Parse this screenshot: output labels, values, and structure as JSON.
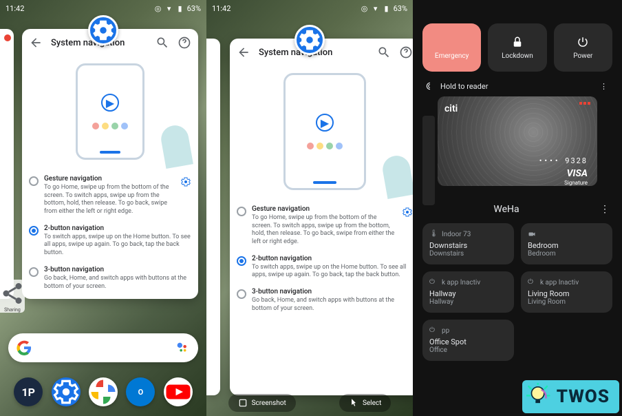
{
  "status": {
    "time1": "11:42",
    "time2": "11:42",
    "battery": "63%"
  },
  "sysnav": {
    "title": "System navigation",
    "options": [
      {
        "key": "gesture",
        "title": "Gesture navigation",
        "desc": "To go Home, swipe up from the bottom of the screen. To switch apps, swipe up from the bottom, hold, then release. To go back, swipe from either the left or right edge."
      },
      {
        "key": "two",
        "title": "2-button navigation",
        "desc": "To switch apps, swipe up on the Home button. To see all apps, swipe up again. To go back, tap the back button."
      },
      {
        "key": "three",
        "title": "3-button navigation",
        "desc": "Go back, Home, and switch apps with buttons at the bottom of your screen."
      }
    ]
  },
  "panel1": {
    "selected": "two",
    "sharing_label": "Sharing"
  },
  "panel2": {
    "selected": "two",
    "actions": {
      "screenshot": "Screenshot",
      "select": "Select"
    }
  },
  "power": {
    "buttons": {
      "emergency": "Emergency",
      "lockdown": "Lockdown",
      "power": "Power"
    },
    "wallet_hint": "Hold to reader",
    "card": {
      "brand": "citi",
      "last4": "9328",
      "network": "VISA",
      "tier": "Signature"
    },
    "home": "WeHa",
    "tiles": [
      {
        "icon": "thermo",
        "status": "Indoor 73",
        "name": "Downstairs",
        "room": "Downstairs"
      },
      {
        "icon": "camera",
        "status": "",
        "name": "Bedroom",
        "room": "Bedroom"
      },
      {
        "icon": "power",
        "status": "k app      Inactiv",
        "name": "Hallway",
        "room": "Hallway"
      },
      {
        "icon": "power",
        "status": "k app      Inactiv",
        "name": "Living Room",
        "room": "Living Room"
      },
      {
        "icon": "power",
        "status": "pp",
        "name": "Office Spot",
        "room": "Office"
      }
    ]
  },
  "watermark": "TWOS",
  "dock": [
    "1password",
    "settings",
    "photos",
    "outlook",
    "youtube"
  ]
}
